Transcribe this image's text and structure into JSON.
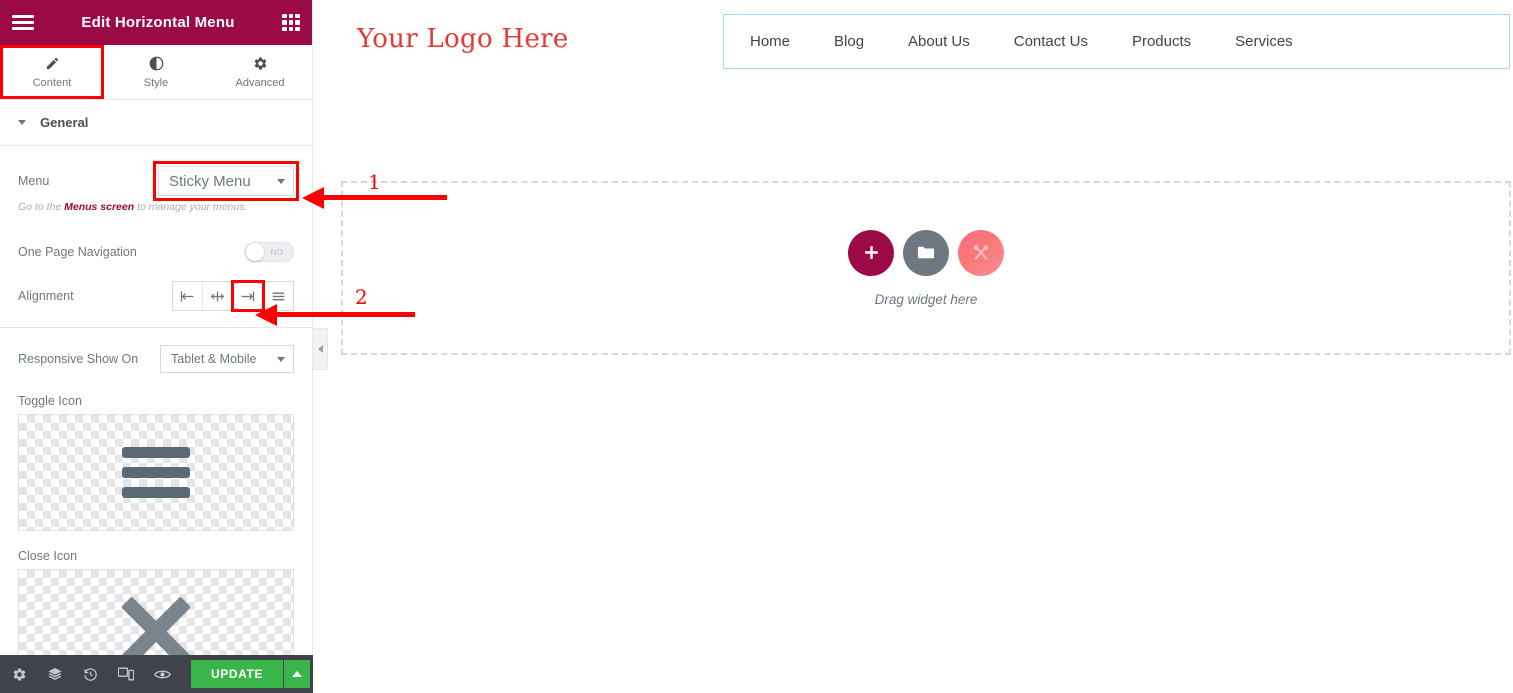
{
  "panel": {
    "header": {
      "title": "Edit Horizontal Menu",
      "menu_icon": "hamburger-icon",
      "grid_icon": "widgets-grid-icon"
    },
    "tabs": [
      {
        "label": "Content",
        "icon": "pencil-icon",
        "active": true
      },
      {
        "label": "Style",
        "icon": "contrast-circle-icon",
        "active": false
      },
      {
        "label": "Advanced",
        "icon": "gear-icon",
        "active": false
      }
    ],
    "section": {
      "title": "General",
      "expanded": true
    },
    "controls": {
      "menu": {
        "label": "Menu",
        "value": "Sticky Menu",
        "options": [
          "Sticky Menu"
        ],
        "highlighted": true
      },
      "menu_help": {
        "prefix": "Go to the ",
        "link": "Menus screen",
        "suffix": " to manage your menus."
      },
      "one_page_navigation": {
        "label": "One Page Navigation",
        "state": "off",
        "state_label": "NO"
      },
      "alignment": {
        "label": "Alignment",
        "options": [
          {
            "name": "align-left-icon",
            "selected": false
          },
          {
            "name": "align-center-icon",
            "selected": false
          },
          {
            "name": "align-right-icon",
            "selected": true
          },
          {
            "name": "align-justify-icon",
            "selected": false
          }
        ]
      },
      "responsive_show_on": {
        "label": "Responsive Show On",
        "value": "Tablet & Mobile",
        "options": [
          "Tablet & Mobile"
        ]
      },
      "toggle_icon": {
        "label": "Toggle Icon",
        "art": "hamburger-art"
      },
      "close_icon": {
        "label": "Close Icon",
        "art": "close-x-art"
      }
    },
    "footer": {
      "icons": [
        "settings-gear-icon",
        "navigator-layers-icon",
        "history-icon",
        "responsive-mode-icon",
        "preview-eye-icon"
      ],
      "update_label": "UPDATE",
      "update_arrow": "chevron-up-icon"
    }
  },
  "canvas": {
    "collapse_handle": "chevron-left-icon",
    "logo_text": "Your Logo Here",
    "nav_items": [
      "Home",
      "Blog",
      "About Us",
      "Contact Us",
      "Products",
      "Services"
    ],
    "dropzone": {
      "caption": "Drag widget here",
      "buttons": [
        {
          "name": "add-section-button",
          "icon": "plus-icon"
        },
        {
          "name": "add-folder-button",
          "icon": "folder-icon"
        },
        {
          "name": "add-template-button",
          "icon": "template-x-icon"
        }
      ]
    }
  },
  "annotations": [
    {
      "number": "1",
      "target": "menu-dropdown"
    },
    {
      "number": "2",
      "target": "alignment-right-button"
    }
  ],
  "colors": {
    "panel_header": "#9b0a46",
    "accent_red": "#ff0000",
    "logo_red": "#e23b34",
    "update_green": "#39b54a",
    "nav_border": "#a8d8ef",
    "footer_bg": "#3f444b"
  }
}
